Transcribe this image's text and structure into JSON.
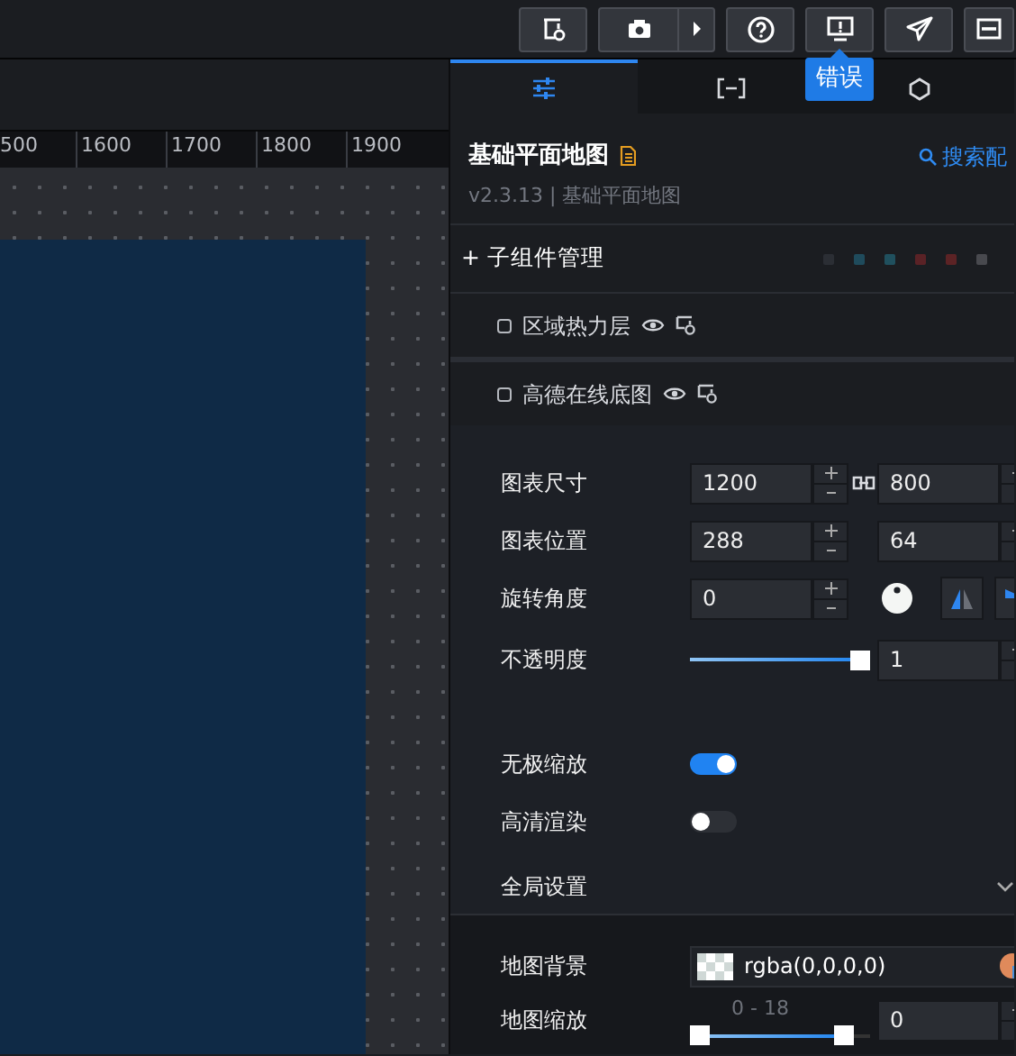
{
  "toolbar": {
    "tooltip": "错误"
  },
  "ruler": {
    "labels": [
      "500",
      "1600",
      "1700",
      "1800",
      "1900"
    ]
  },
  "panel_tabs": [
    {
      "selected": true
    },
    {
      "selected": false
    },
    {
      "selected": false
    }
  ],
  "component": {
    "title": "基础平面地图",
    "search": "搜索配",
    "version": "v2.3.13 | 基础平面地图"
  },
  "children_manager": {
    "label": "+ 子组件管理",
    "dots": [
      {
        "color": "#2b2e34"
      },
      {
        "color": "#1f4b5c"
      },
      {
        "color": "#20505e"
      },
      {
        "color": "#5a2226"
      },
      {
        "color": "#5c2325"
      },
      {
        "color": "#48494e"
      }
    ]
  },
  "sub_components": [
    {
      "name": "区域热力层"
    },
    {
      "name": "高德在线底图"
    }
  ],
  "properties": [
    {
      "kind": "pair",
      "label": "图表尺寸",
      "values": [
        "1200",
        "800"
      ],
      "linked": true
    },
    {
      "kind": "pair",
      "label": "图表位置",
      "values": [
        "288",
        "64"
      ],
      "linked": false
    },
    {
      "kind": "rotation",
      "label": "旋转角度",
      "value": "0"
    },
    {
      "kind": "slider",
      "label": "不透明度",
      "level": 1,
      "value": "1"
    },
    {
      "kind": "spacer"
    },
    {
      "kind": "switch",
      "label": "无极缩放",
      "on": true
    },
    {
      "kind": "switch",
      "label": "高清渲染",
      "on": false
    },
    {
      "kind": "group",
      "label": "全局设置",
      "expanded": true
    }
  ],
  "global_settings": [
    {
      "kind": "color",
      "label": "地图背景",
      "value": "rgba(0,0,0,0)"
    },
    {
      "kind": "range",
      "label": "地图缩放",
      "range_label": "0 - 18",
      "level": 0.9,
      "value": "0"
    }
  ]
}
